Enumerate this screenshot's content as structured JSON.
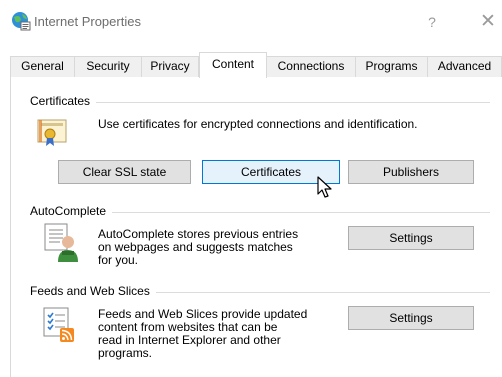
{
  "window": {
    "title": "Internet Properties",
    "help_glyph": "?",
    "close_glyph": "✕"
  },
  "tabs": [
    {
      "label": "General"
    },
    {
      "label": "Security"
    },
    {
      "label": "Privacy"
    },
    {
      "label": "Content",
      "active": true
    },
    {
      "label": "Connections"
    },
    {
      "label": "Programs"
    },
    {
      "label": "Advanced"
    }
  ],
  "certificates": {
    "header": "Certificates",
    "description": "Use certificates for encrypted connections and identification.",
    "clear_ssl_label": "Clear SSL state",
    "certificates_label": "Certificates",
    "publishers_label": "Publishers",
    "icon": "certificate-icon"
  },
  "autocomplete": {
    "header": "AutoComplete",
    "description_lines": [
      "AutoComplete stores previous entries",
      "on webpages and suggests matches",
      "for you."
    ],
    "settings_label": "Settings",
    "icon": "autocomplete-icon"
  },
  "feeds": {
    "header": "Feeds and Web Slices",
    "description_lines": [
      "Feeds and Web Slices provide updated",
      "content from websites that can be",
      "read in Internet Explorer and other",
      "programs."
    ],
    "settings_label": "Settings",
    "icon": "feeds-icon"
  },
  "colors": {
    "accent": "#0078d7",
    "button_face": "#e1e1e1",
    "button_hover": "#e5f1fb",
    "border": "#adadad"
  }
}
